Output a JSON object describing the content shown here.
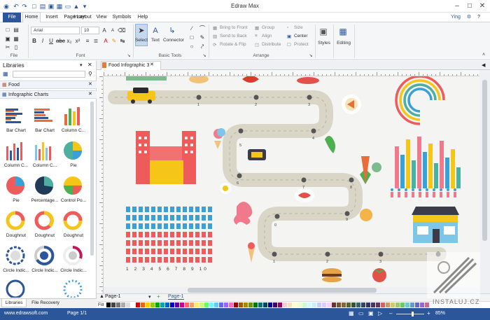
{
  "app": {
    "title": "Edraw Max"
  },
  "menu": {
    "file": "File",
    "items": [
      "Home",
      "Insert",
      "Page Layout",
      "View",
      "Symbols",
      "Help"
    ],
    "user": "Ying"
  },
  "ribbon": {
    "file_group": {
      "label": "File"
    },
    "font_group": {
      "label": "Font",
      "font_name": "Arial",
      "font_size": "10"
    },
    "basic_tools": {
      "label": "Basic Tools",
      "select": "Select",
      "text": "Text",
      "connector": "Connector"
    },
    "arrange": {
      "label": "Arrange",
      "bring_to_front": "Bring to Front",
      "send_to_back": "Send to Back",
      "rotate_flip": "Rotate & Flip",
      "group": "Group",
      "align": "Align",
      "distribute": "Distribute",
      "size": "Size",
      "center": "Center",
      "protect": "Protect"
    },
    "styles": "Styles",
    "editing": "Editing"
  },
  "libraries": {
    "title": "Libraries",
    "categories": [
      "Food",
      "Infographic Charts"
    ],
    "shapes": [
      "Bar Chart",
      "Bar Chart",
      "Column C...",
      "Column C...",
      "Column C...",
      "Pie",
      "Pie",
      "Percentage...",
      "Control Po...",
      "Doughnut",
      "Doughnut",
      "Doughnut",
      "Circle Indic...",
      "Circle Indic...",
      "Circle Indic..."
    ],
    "bottom_tabs": [
      "Libraries",
      "File Recovery"
    ]
  },
  "document": {
    "tab": "Food Infographic 3",
    "page_tab": "Page-1",
    "active_page": "Page-1",
    "fill_label": "Fill"
  },
  "canvas": {
    "road_numbers": [
      "1",
      "2",
      "3",
      "4",
      "5",
      "6",
      "7",
      "8",
      "9",
      "0",
      "1",
      "2",
      "3"
    ],
    "grid_numbers": "1 2 3 4 5 6 7 8 9 10"
  },
  "status": {
    "website": "www.edrawsoft.com",
    "page": "Page 1/1",
    "zoom": "85%"
  },
  "watermark": "INSTALUJ.CZ"
}
